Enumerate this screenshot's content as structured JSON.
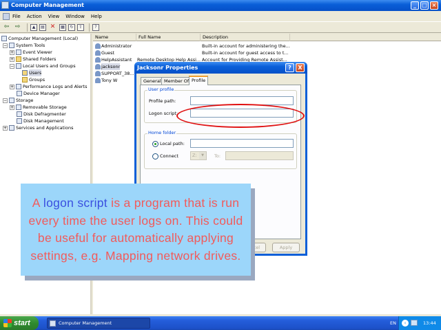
{
  "main_window": {
    "title": "Computer Management",
    "menus": [
      "File",
      "Action",
      "View",
      "Window",
      "Help"
    ]
  },
  "tree": [
    {
      "label": "Computer Management (Local)",
      "level": 0,
      "expander": ""
    },
    {
      "label": "System Tools",
      "level": 1,
      "expander": "−"
    },
    {
      "label": "Event Viewer",
      "level": 2,
      "expander": "+"
    },
    {
      "label": "Shared Folders",
      "level": 2,
      "expander": "+"
    },
    {
      "label": "Local Users and Groups",
      "level": 2,
      "expander": "−"
    },
    {
      "label": "Users",
      "level": 3,
      "expander": "",
      "selected": true
    },
    {
      "label": "Groups",
      "level": 3,
      "expander": ""
    },
    {
      "label": "Performance Logs and Alerts",
      "level": 2,
      "expander": "+"
    },
    {
      "label": "Device Manager",
      "level": 2,
      "expander": ""
    },
    {
      "label": "Storage",
      "level": 1,
      "expander": "−"
    },
    {
      "label": "Removable Storage",
      "level": 2,
      "expander": "+"
    },
    {
      "label": "Disk Defragmenter",
      "level": 2,
      "expander": ""
    },
    {
      "label": "Disk Management",
      "level": 2,
      "expander": ""
    },
    {
      "label": "Services and Applications",
      "level": 1,
      "expander": "+"
    }
  ],
  "list": {
    "columns": [
      "Name",
      "Full Name",
      "Description"
    ],
    "rows": [
      {
        "name": "Administrator",
        "full_name": "",
        "description": "Built-in account for administering the..."
      },
      {
        "name": "Guest",
        "full_name": "",
        "description": "Built-in account for guest access to t..."
      },
      {
        "name": "HelpAssistant",
        "full_name": "Remote Desktop Help Assi...",
        "description": "Account for Providing Remote Assist..."
      },
      {
        "name": "jacksonr",
        "full_name": "",
        "description": ""
      },
      {
        "name": "SUPPORT_38...",
        "full_name": "",
        "description": ""
      },
      {
        "name": "Tony W",
        "full_name": "",
        "description": ""
      }
    ]
  },
  "dialog": {
    "title": "Jacksonr Properties",
    "help_label": "?",
    "close_label": "X",
    "tabs": [
      "General",
      "Member Of",
      "Profile"
    ],
    "user_profile_group": "User profile",
    "profile_path_label": "Profile path:",
    "profile_path_value": "",
    "logon_script_label": "Logon script:",
    "logon_script_value": "",
    "home_folder_group": "Home folder",
    "local_path_label": "Local path:",
    "connect_label": "Connect",
    "drive_value": "Z:",
    "to_label": "To:",
    "cancel_label": "Cancel",
    "apply_label": "Apply"
  },
  "callout": {
    "prefix": "A ",
    "keyword": "logon script",
    "rest": " is a program that is run every time the user logs on. This could be useful for automatically applying settings, e.g. Mapping network drives."
  },
  "taskbar": {
    "start_label": "start",
    "task_label": "Computer Management",
    "language": "EN",
    "clock": "13:44"
  },
  "colors": {
    "callout_bg": "#9cd6fa",
    "callout_text": "#f25a5a",
    "callout_keyword": "#3a4fe0",
    "highlight_ring": "#e01010"
  }
}
